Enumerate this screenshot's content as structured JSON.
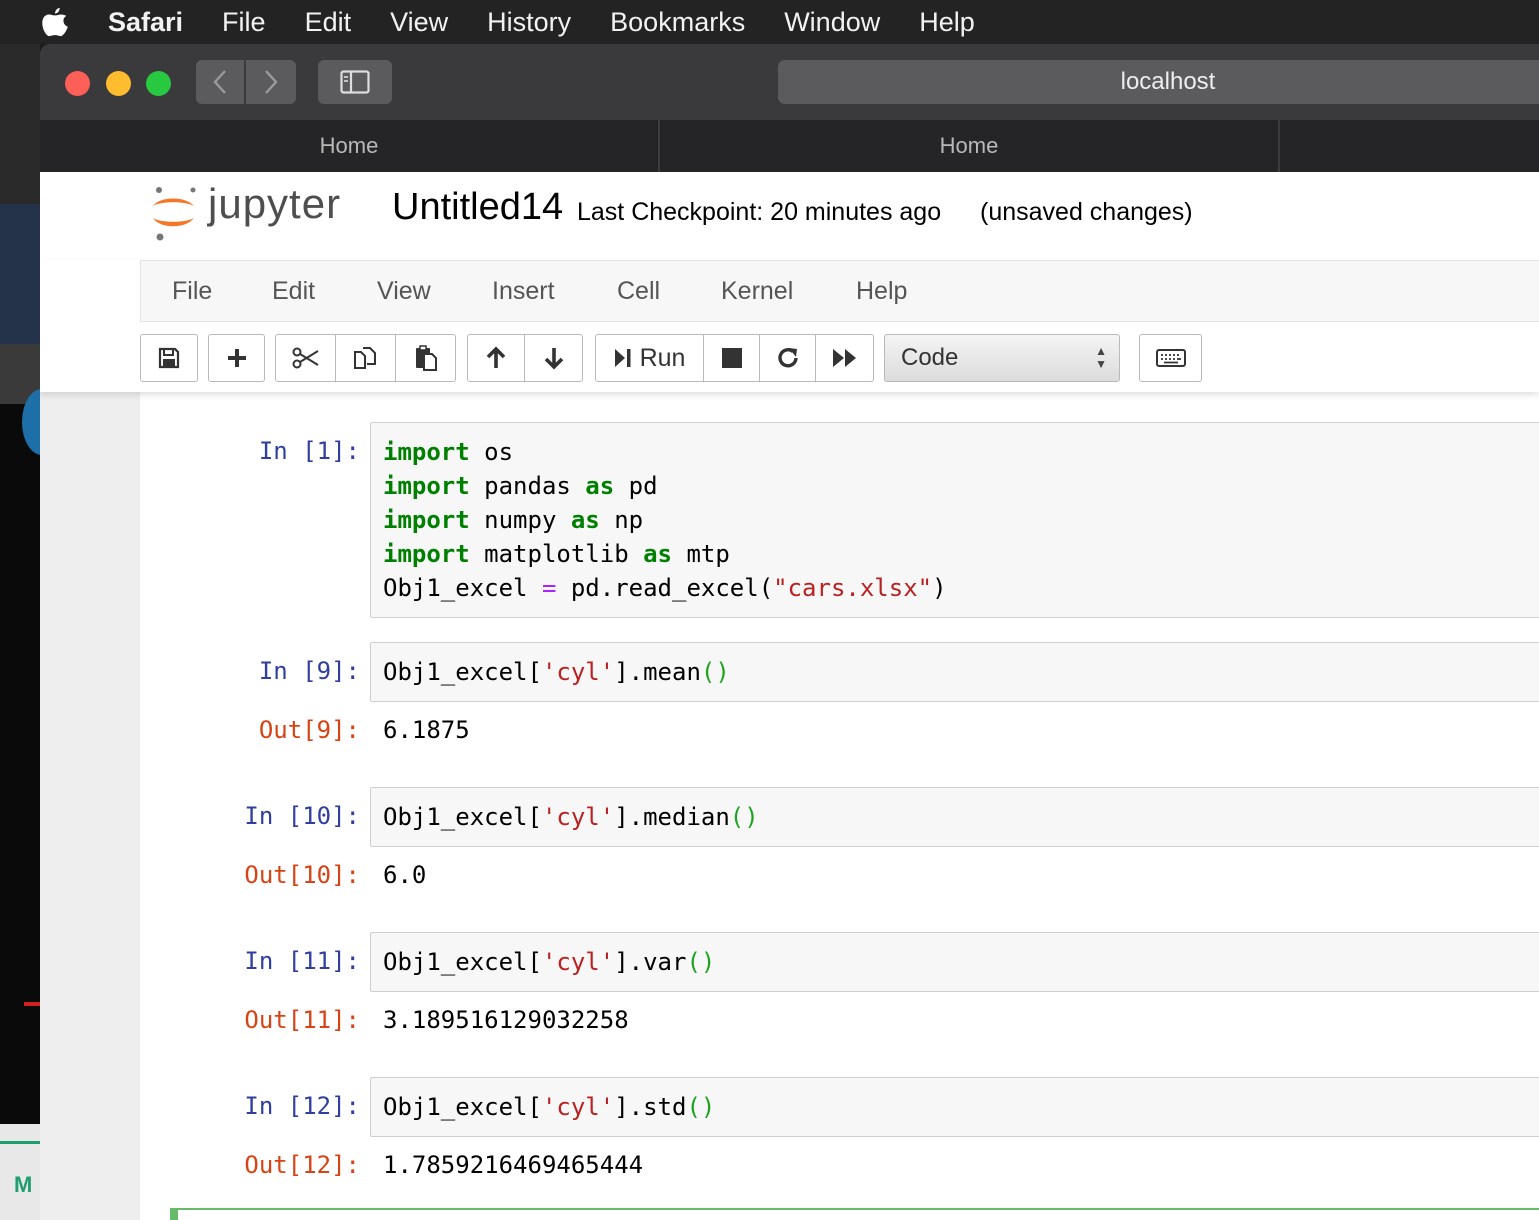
{
  "menubar": {
    "items": [
      "Safari",
      "File",
      "Edit",
      "View",
      "History",
      "Bookmarks",
      "Window",
      "Help"
    ]
  },
  "safari": {
    "url": "localhost",
    "tabs": [
      {
        "label": "Home"
      },
      {
        "label": "Home"
      }
    ]
  },
  "notebook": {
    "logo_text": "jupyter",
    "name": "Untitled14",
    "checkpoint": "Last Checkpoint: 20 minutes ago",
    "status": "(unsaved changes)",
    "menu": [
      "File",
      "Edit",
      "View",
      "Insert",
      "Cell",
      "Kernel",
      "Help"
    ],
    "toolbar": {
      "run_label": "Run",
      "cell_type": "Code"
    }
  },
  "cells": [
    {
      "in_prompt": "In [1]:",
      "code_lines": [
        "import os",
        "import pandas as pd",
        "import numpy as np",
        "import matplotlib as mtp",
        "Obj1_excel = pd.read_excel(\"cars.xlsx\")"
      ]
    },
    {
      "in_prompt": "In [9]:",
      "code": "Obj1_excel['cyl'].mean()",
      "out_prompt": "Out[9]:",
      "output": "6.1875"
    },
    {
      "in_prompt": "In [10]:",
      "code": "Obj1_excel['cyl'].median()",
      "out_prompt": "Out[10]:",
      "output": "6.0"
    },
    {
      "in_prompt": "In [11]:",
      "code": "Obj1_excel['cyl'].var()",
      "out_prompt": "Out[11]:",
      "output": "3.189516129032258"
    },
    {
      "in_prompt": "In [12]:",
      "code": "Obj1_excel['cyl'].std()",
      "out_prompt": "Out[12]:",
      "output": "1.7859216469465444"
    }
  ],
  "colors": {
    "jupyter_orange": "#f37726",
    "keyword_green": "#008000",
    "string_red": "#ba2121",
    "in_prompt_blue": "#303f9f",
    "out_prompt_red": "#d84315",
    "active_cell_green": "#66bb6a"
  },
  "icons": [
    "apple-icon",
    "back-icon",
    "forward-icon",
    "sidebar-icon",
    "save-icon",
    "plus-icon",
    "cut-icon",
    "copy-icon",
    "paste-icon",
    "arrow-up-icon",
    "arrow-down-icon",
    "run-icon",
    "stop-icon",
    "restart-icon",
    "fast-forward-icon",
    "keyboard-icon"
  ]
}
